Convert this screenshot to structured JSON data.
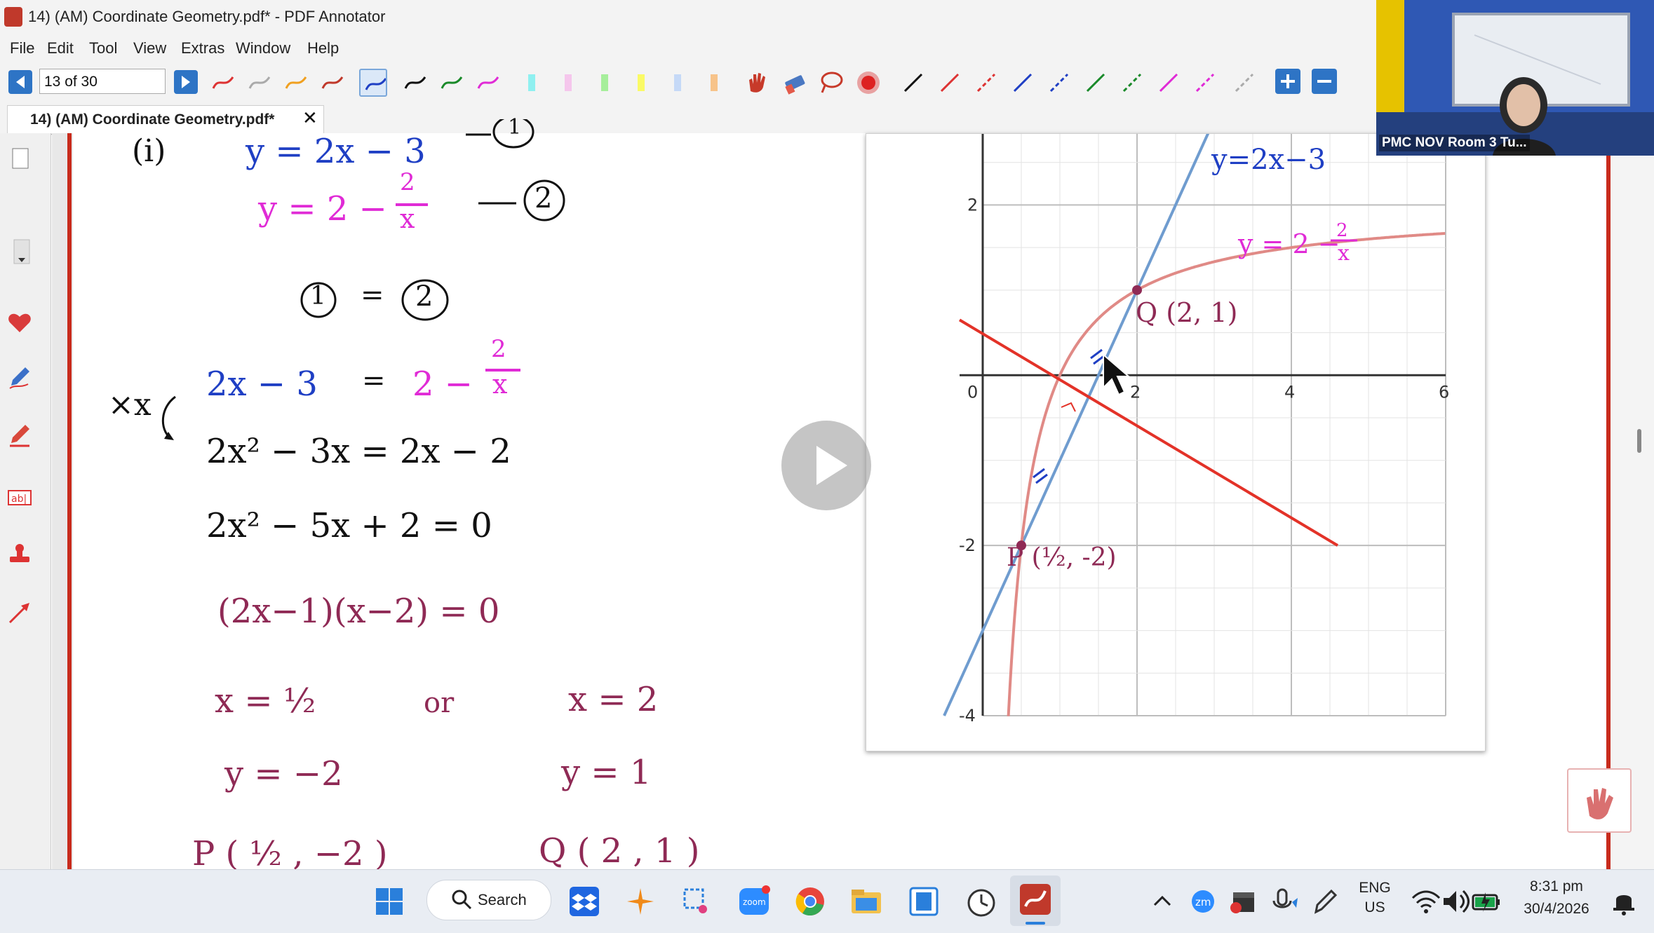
{
  "window": {
    "title": "14) (AM) Coordinate Geometry.pdf* - PDF Annotator"
  },
  "menu": [
    "File",
    "Edit",
    "Tool",
    "View",
    "Extras",
    "Window",
    "Help"
  ],
  "toolbar": {
    "page_indicator": "13 of 30"
  },
  "tab": {
    "label": "14) (AM) Coordinate Geometry.pdf*",
    "close": "✕"
  },
  "notes": {
    "line_i_label": "(i)",
    "eq1": "y = 2x − 3",
    "eq1_tag": "1",
    "eq2_left": "y = 2 −",
    "eq2_num": "2",
    "eq2_den": "x",
    "eq2_tag": "2",
    "equate_a": "1",
    "equate_eq": "=",
    "equate_b": "2",
    "step1_left": "2x − 3",
    "step1_eq": "=",
    "step1_right": "2 −",
    "step1_num": "2",
    "step1_den": "x",
    "multiply_note": "×x",
    "step2": "2x² − 3x = 2x − 2",
    "step3": "2x² − 5x + 2 = 0",
    "step4": "(2x−1)(x−2) = 0",
    "sol_x1": "x = ½",
    "or": "or",
    "sol_x2": "x = 2",
    "sol_y1": "y = −2",
    "sol_y2": "y = 1",
    "point_p_partial": "P ( ½ , −2 )",
    "point_q_partial": "Q ( 2 , 1 )"
  },
  "chart_data": {
    "type": "line",
    "xlim": [
      -1,
      6
    ],
    "ylim": [
      -4,
      3
    ],
    "x_ticks": [
      "0",
      "2",
      "4",
      "6"
    ],
    "y_ticks": [
      "2",
      "-2",
      "-4"
    ],
    "grid": true,
    "series": [
      {
        "name": "y=2x-3",
        "color": "#6f9ccf",
        "kind": "line",
        "slope": 2,
        "intercept": -3
      },
      {
        "name": "y=2-2/x",
        "color": "#e08a86",
        "kind": "curve"
      },
      {
        "color": "#e33228",
        "kind": "segment",
        "points": [
          [
            -0.3,
            0.65
          ],
          [
            4.6,
            -2
          ]
        ]
      }
    ],
    "points": [
      {
        "label": "Q(2, 1)",
        "x": 2,
        "y": 1
      },
      {
        "label": "P(½, -2)",
        "x": 0.5,
        "y": -2
      }
    ],
    "annotations": {
      "line_label": "y=2x−3",
      "curve_label_left": "y = 2 −",
      "curve_label_num": "2",
      "curve_label_den": "x",
      "label_q": "Q (2, 1)",
      "label_p": "P (½, -2)"
    }
  },
  "video": {
    "participant_label": "PMC NOV Room 3 Tu..."
  },
  "taskbar": {
    "search_label": "Search",
    "language_line1": "ENG",
    "language_line2": "US",
    "time": "8:31 pm",
    "date": "30/4/2026"
  }
}
